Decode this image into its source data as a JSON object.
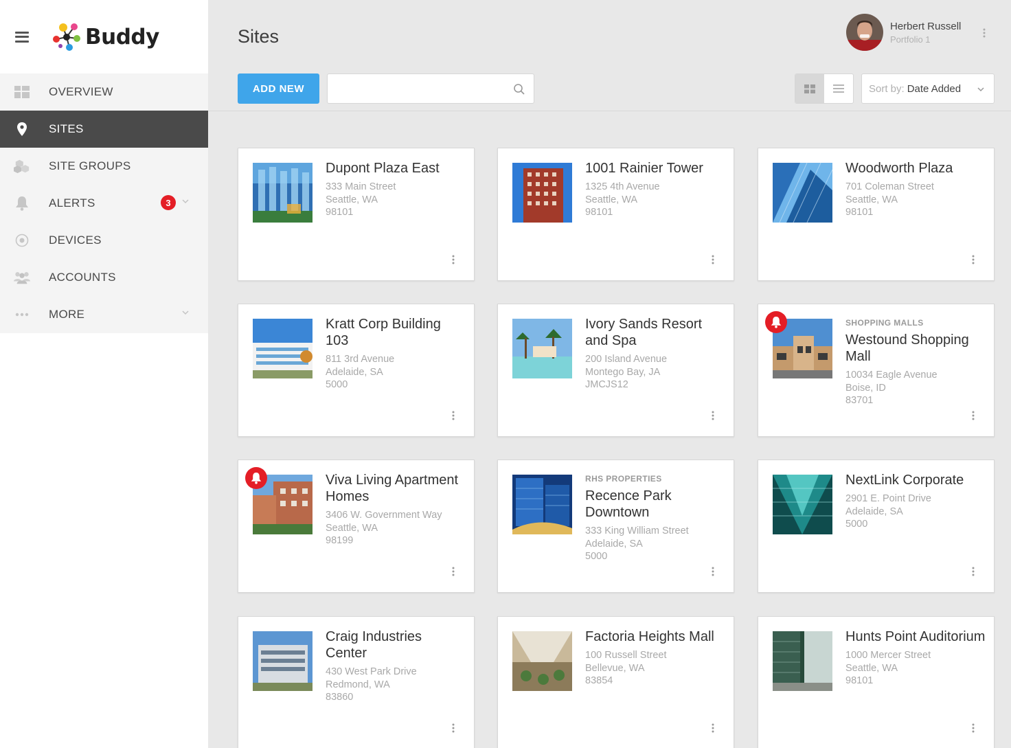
{
  "app": {
    "brand": "Buddy"
  },
  "sidebar": {
    "items": [
      {
        "label": "OVERVIEW",
        "icon": "grid-icon"
      },
      {
        "label": "SITES",
        "icon": "map-pin-icon",
        "active": true
      },
      {
        "label": "SITE GROUPS",
        "icon": "cubes-icon"
      },
      {
        "label": "ALERTS",
        "icon": "bell-icon",
        "badge": "3"
      },
      {
        "label": "DEVICES",
        "icon": "device-circle-icon"
      },
      {
        "label": "ACCOUNTS",
        "icon": "users-icon"
      },
      {
        "label": "MORE",
        "icon": "more-dots-icon"
      }
    ]
  },
  "header": {
    "title": "Sites"
  },
  "user": {
    "name": "Herbert Russell",
    "subtitle": "Portfolio 1"
  },
  "toolbar": {
    "add_label": "ADD NEW",
    "search_placeholder": "",
    "sort_prefix": "Sort by:",
    "sort_value": "Date Added"
  },
  "colors": {
    "accent": "#3fa5ea",
    "alert": "#e41e26",
    "active_nav": "#4a4a4a"
  },
  "sites": [
    {
      "title": "Dupont Plaza East",
      "street": "333 Main Street",
      "city": "Seattle, WA",
      "zip": "98101",
      "group": "",
      "alert": false
    },
    {
      "title": "1001 Rainier Tower",
      "street": "1325 4th Avenue",
      "city": "Seattle, WA",
      "zip": "98101",
      "group": "",
      "alert": false
    },
    {
      "title": "Woodworth Plaza",
      "street": "701 Coleman Street",
      "city": "Seattle, WA",
      "zip": "98101",
      "group": "",
      "alert": false
    },
    {
      "title": "Kratt Corp Building 103",
      "street": "811 3rd Avenue",
      "city": "Adelaide, SA",
      "zip": "5000",
      "group": "",
      "alert": false
    },
    {
      "title": "Ivory Sands Resort and Spa",
      "street": "200 Island Avenue",
      "city": "Montego Bay, JA",
      "zip": "JMCJS12",
      "group": "",
      "alert": false
    },
    {
      "title": "Westound Shopping Mall",
      "street": "10034 Eagle Avenue",
      "city": "Boise, ID",
      "zip": "83701",
      "group": "SHOPPING MALLS",
      "alert": true
    },
    {
      "title": "Viva Living Apartment Homes",
      "street": "3406 W. Government Way",
      "city": "Seattle, WA",
      "zip": "98199",
      "group": "",
      "alert": true
    },
    {
      "title": "Recence Park Downtown",
      "street": "333 King William Street",
      "city": "Adelaide, SA",
      "zip": "5000",
      "group": "RHS PROPERTIES",
      "alert": false
    },
    {
      "title": "NextLink Corporate",
      "street": "2901 E. Point Drive",
      "city": "Adelaide, SA",
      "zip": "5000",
      "group": "",
      "alert": false
    },
    {
      "title": "Craig Industries Center",
      "street": "430 West Park Drive",
      "city": "Redmond, WA",
      "zip": "83860",
      "group": "",
      "alert": false
    },
    {
      "title": "Factoria Heights Mall",
      "street": "100 Russell Street",
      "city": "Bellevue, WA",
      "zip": "83854",
      "group": "",
      "alert": false
    },
    {
      "title": "Hunts Point Auditorium",
      "street": "1000 Mercer Street",
      "city": "Seattle, WA",
      "zip": "98101",
      "group": "",
      "alert": false
    }
  ]
}
